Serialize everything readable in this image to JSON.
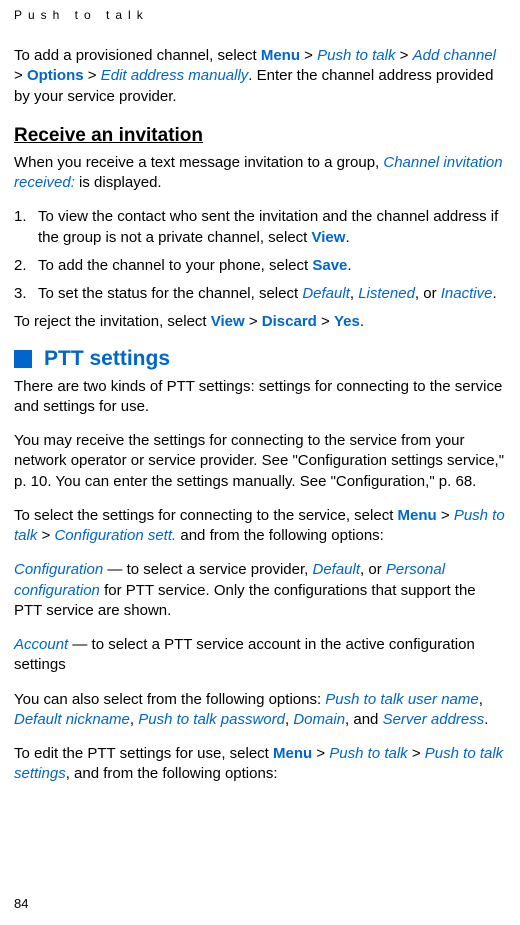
{
  "header": "Push to talk",
  "pageNumber": "84",
  "intro": {
    "t1": "To add a provisioned channel, select ",
    "menu": "Menu",
    "gt1": " > ",
    "ptt": "Push to talk",
    "gt2": " > ",
    "addchannel": "Add channel",
    "gt3": " > ",
    "options": "Options",
    "gt4": " > ",
    "editaddr": "Edit address manually",
    "t2": ". Enter the channel address provided by your service provider."
  },
  "receiveTitle": "Receive an invitation",
  "receive": {
    "p1a": "When you receive a text message invitation to a group, ",
    "p1b": "Channel invitation received:",
    "p1c": " is displayed.",
    "li1num": "1.",
    "li1a": "To view the contact who sent the invitation and the channel address if the group is not a private channel, select ",
    "li1b": "View",
    "li1c": ".",
    "li2num": "2.",
    "li2a": "To add the channel to your phone, select ",
    "li2b": "Save",
    "li2c": ".",
    "li3num": "3.",
    "li3a": "To set the status for the channel, select ",
    "li3b": "Default",
    "li3c": ", ",
    "li3d": "Listened",
    "li3e": ", or ",
    "li3f": "Inactive",
    "li3g": ".",
    "rej1": "To reject the invitation, select ",
    "rej2": "View",
    "rej3": " > ",
    "rej4": "Discard",
    "rej5": " > ",
    "rej6": "Yes",
    "rej7": "."
  },
  "pttTitle": "PTT settings",
  "ptt": {
    "p1": "There are two kinds of PTT settings: settings for connecting to the service and settings for use.",
    "p2": "You may receive the settings for connecting to the service from your network operator or service provider. See \"Configuration settings service,\" p. 10. You can enter the settings manually. See \"Configuration,\" p. 68.",
    "p3a": "To select the settings for connecting to the service, select ",
    "p3b": "Menu",
    "p3c": " > ",
    "p3d": "Push to talk",
    "p3e": " > ",
    "p3f": "Configuration sett.",
    "p3g": " and from the following options:",
    "p4a": "Configuration",
    "p4b": " — to select a service provider, ",
    "p4c": "Default",
    "p4d": ", or ",
    "p4e": "Personal configuration",
    "p4f": " for PTT service. Only the configurations that support the PTT service are shown.",
    "p5a": "Account",
    "p5b": " — to select a PTT service account in the active configuration settings",
    "p6a": "You can also select from the following options: ",
    "p6b": "Push to talk user name",
    "p6c": ", ",
    "p6d": "Default nickname",
    "p6e": ", ",
    "p6f": "Push to talk password",
    "p6g": ", ",
    "p6h": "Domain",
    "p6i": ", and ",
    "p6j": "Server address",
    "p6k": ".",
    "p7a": "To edit the PTT settings for use, select ",
    "p7b": "Menu",
    "p7c": " > ",
    "p7d": "Push to talk",
    "p7e": " > ",
    "p7f": "Push to talk settings",
    "p7g": ", and from the following options:"
  }
}
